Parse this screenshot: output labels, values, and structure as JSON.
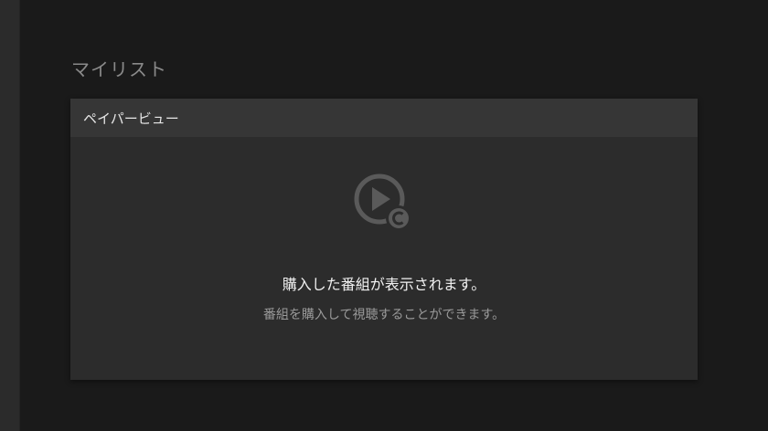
{
  "page": {
    "title": "マイリスト"
  },
  "card": {
    "header_title": "ペイパービュー",
    "empty_state": {
      "icon": "play-paid-icon",
      "heading": "購入した番組が表示されます。",
      "subtext": "番組を購入して視聴することができます。"
    }
  },
  "colors": {
    "background": "#1a1a1a",
    "card": "#2c2c2c",
    "card_header": "#363636",
    "icon": "#5a5a5a"
  }
}
